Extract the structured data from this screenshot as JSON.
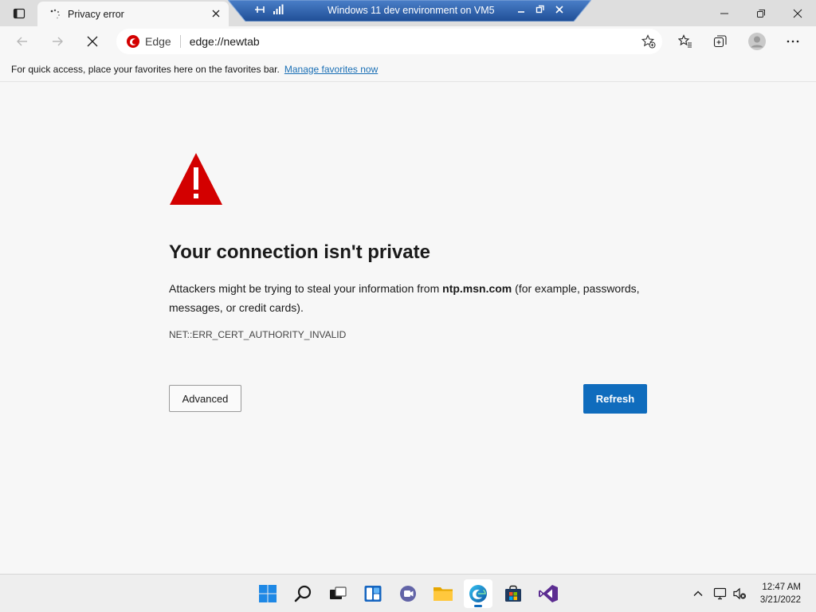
{
  "tab": {
    "title": "Privacy error"
  },
  "vm": {
    "title": "Windows 11 dev environment on VM5"
  },
  "omnibox": {
    "brand": "Edge",
    "url": "edge://newtab"
  },
  "favorites_bar": {
    "text": "For quick access, place your favorites here on the favorites bar.",
    "link": "Manage favorites now"
  },
  "error": {
    "heading": "Your connection isn't private",
    "desc_prefix": "Attackers might be trying to steal your information from ",
    "desc_host": "ntp.msn.com",
    "desc_suffix": " (for example, passwords, messages, or credit cards).",
    "code": "NET::ERR_CERT_AUTHORITY_INVALID",
    "advanced_label": "Advanced",
    "refresh_label": "Refresh"
  },
  "clock": {
    "time": "12:47 AM",
    "date": "3/21/2022"
  },
  "colors": {
    "accent": "#0f6cbd",
    "warning": "#d30000",
    "vm_bar": "#2b5797"
  }
}
